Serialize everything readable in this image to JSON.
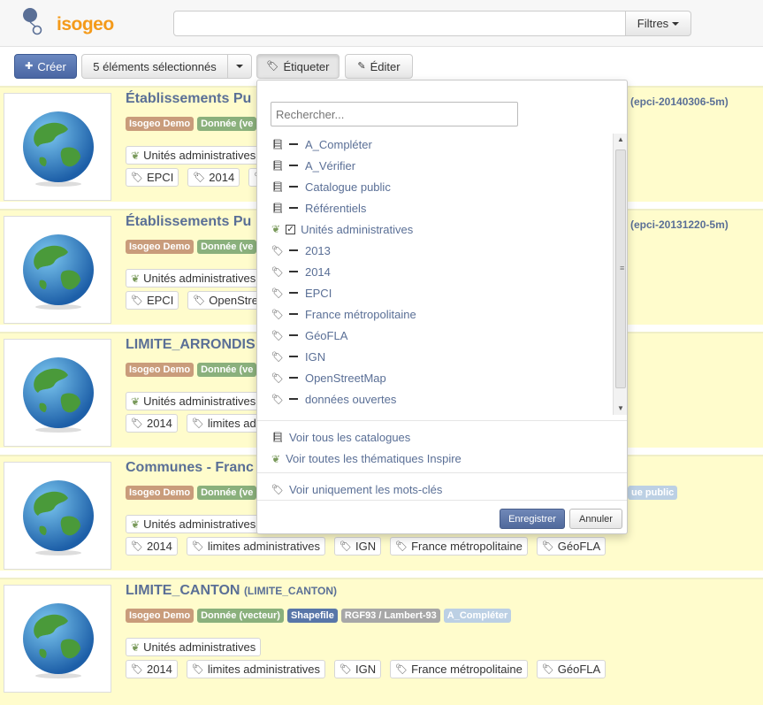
{
  "app": {
    "logo_text": "isogeo",
    "brand_color": "#f49a1a",
    "accent_color": "#5a6f96"
  },
  "search": {
    "value": "",
    "placeholder": "",
    "filters_label": "Filtres"
  },
  "toolbar": {
    "create_label": "Créer",
    "selection_label": "5 éléments sélectionnés",
    "tag_label": "Étiqueter",
    "edit_label": "Éditer"
  },
  "rows": [
    {
      "title": "Établissements Pu",
      "code": "(epci-20140306-5m)",
      "badges": [
        "Isogeo Demo",
        "Donnée (ve"
      ],
      "theme": "Unités administratives",
      "keywords": [
        "EPCI",
        "2014",
        ""
      ]
    },
    {
      "title": "Établissements Pu",
      "code": "(epci-20131220-5m)",
      "badges": [
        "Isogeo Demo",
        "Donnée (ve"
      ],
      "theme": "Unités administratives",
      "keywords": [
        "EPCI",
        "OpenStree"
      ]
    },
    {
      "title": "LIMITE_ARRONDIS",
      "badges": [
        "Isogeo Demo",
        "Donnée (ve"
      ],
      "theme": "Unités administratives",
      "keywords": [
        "2014",
        "limites adm"
      ]
    },
    {
      "title": "Communes - Franc",
      "badges": [
        "Isogeo Demo",
        "Donnée (ve"
      ],
      "extra_badge": "ue public",
      "theme": "Unités administratives",
      "keywords": [
        "2014",
        "limites administratives",
        "IGN",
        "France métropolitaine",
        "GéoFLA"
      ]
    },
    {
      "title": "LIMITE_CANTON",
      "subtitle": "(LIMITE_CANTON)",
      "badges": [
        "Isogeo Demo",
        "Donnée (vecteur)",
        "Shapefile",
        "RGF93 / Lambert-93",
        "A_Compléter"
      ],
      "theme": "Unités administratives",
      "keywords": [
        "2014",
        "limites administratives",
        "IGN",
        "France métropolitaine",
        "GéoFLA"
      ]
    }
  ],
  "dropdown": {
    "search_placeholder": "Rechercher...",
    "items": [
      {
        "icon": "book-icon",
        "label": "A_Compléter"
      },
      {
        "icon": "book-icon",
        "label": "A_Vérifier"
      },
      {
        "icon": "book-icon",
        "label": "Catalogue public"
      },
      {
        "icon": "book-icon",
        "label": "Référentiels"
      },
      {
        "icon": "leaf-icon",
        "label": "Unités administratives",
        "checked": true
      },
      {
        "icon": "tag-icon",
        "label": "2013"
      },
      {
        "icon": "tag-icon",
        "label": "2014"
      },
      {
        "icon": "tag-icon",
        "label": "EPCI"
      },
      {
        "icon": "tag-icon",
        "label": "France métropolitaine"
      },
      {
        "icon": "tag-icon",
        "label": "GéoFLA"
      },
      {
        "icon": "tag-icon",
        "label": "IGN"
      },
      {
        "icon": "tag-icon",
        "label": "OpenStreetMap"
      },
      {
        "icon": "tag-icon",
        "label": "données ouvertes"
      }
    ],
    "link_catalogues": "Voir tous les catalogues",
    "link_themes": "Voir toutes les thématiques Inspire",
    "link_keywords": "Voir uniquement les mots-clés",
    "save_label": "Enregistrer",
    "cancel_label": "Annuler"
  }
}
